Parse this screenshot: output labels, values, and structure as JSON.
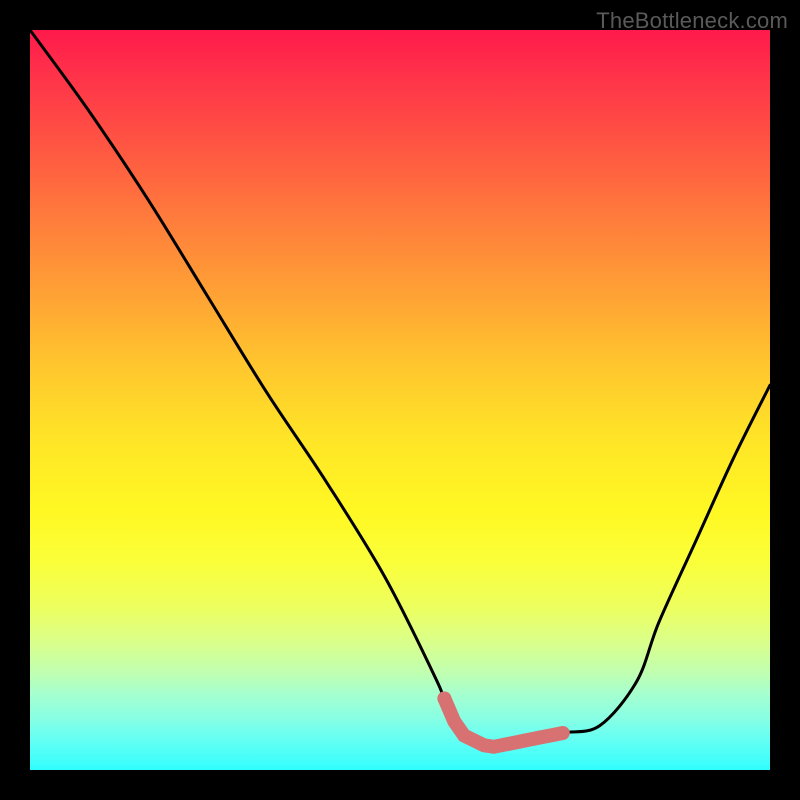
{
  "watermark": "TheBottleneck.com",
  "chart_data": {
    "type": "line",
    "title": "",
    "xlabel": "",
    "ylabel": "",
    "xlim": [
      0,
      100
    ],
    "ylim": [
      0,
      100
    ],
    "x": [
      0,
      8,
      16,
      24,
      32,
      40,
      48,
      55,
      58,
      62,
      67,
      72,
      77,
      82,
      85,
      90,
      95,
      100
    ],
    "values": [
      100,
      89,
      77,
      64,
      51,
      39,
      26,
      12,
      5,
      3,
      4,
      5,
      6,
      12,
      20,
      31,
      42,
      52
    ],
    "highlight_range_x": [
      56,
      72
    ],
    "highlight_dot_x": 56,
    "colors": {
      "curve": "#000000",
      "highlight": "#d87272",
      "gradient_top": "#ff1a4b",
      "gradient_bottom": "#2dfdff"
    }
  }
}
